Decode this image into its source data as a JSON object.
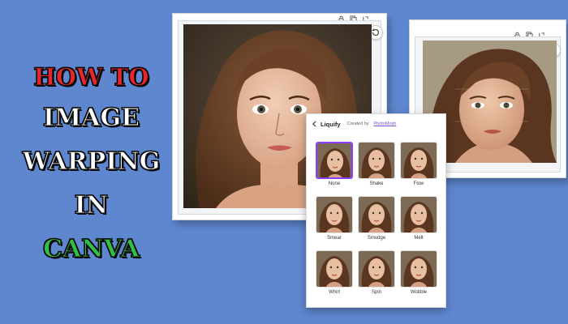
{
  "title": {
    "line1": "HOW TO",
    "line2": "IMAGE",
    "line3": "WARPING",
    "line4": "IN",
    "line5": "CANVA"
  },
  "colors": {
    "background": "#5f87cf",
    "red": "#e8262c",
    "white": "#ffffff",
    "green": "#2fbf4a",
    "accent": "#8b3dff"
  },
  "icons": {
    "lock": "lock-icon",
    "duplicate": "duplicate-icon",
    "expand": "expand-icon",
    "rotate": "rotate-icon",
    "back": "chevron-left-icon"
  },
  "panel": {
    "title": "Liquify",
    "credit_prefix": "Created by",
    "credit_link": "PhotoMosh",
    "selected": "None",
    "effects": [
      {
        "label": "None"
      },
      {
        "label": "Shake"
      },
      {
        "label": "Flow"
      },
      {
        "label": "Smear"
      },
      {
        "label": "Smudge"
      },
      {
        "label": "Melt"
      },
      {
        "label": "Whirl"
      },
      {
        "label": "Spin"
      },
      {
        "label": "Wobble"
      }
    ]
  }
}
